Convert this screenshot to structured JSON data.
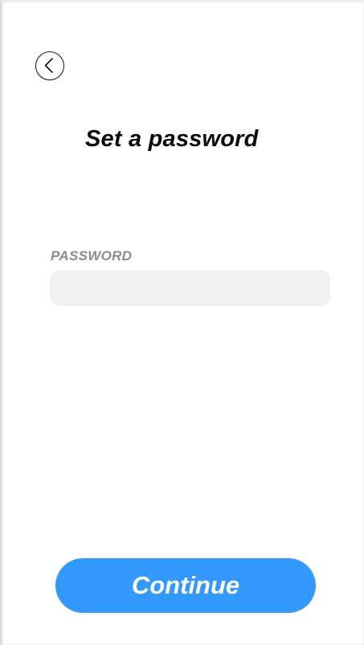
{
  "header": {
    "back_icon": "chevron-left-icon",
    "title": "Set a password"
  },
  "form": {
    "password_label": "PASSWORD",
    "password_value": "",
    "password_placeholder": ""
  },
  "actions": {
    "continue_label": "Continue"
  },
  "colors": {
    "accent": "#3399ff",
    "input_background": "#f1f1f1",
    "label_text": "#8c8c8c",
    "title_text": "#0a0a0a"
  }
}
